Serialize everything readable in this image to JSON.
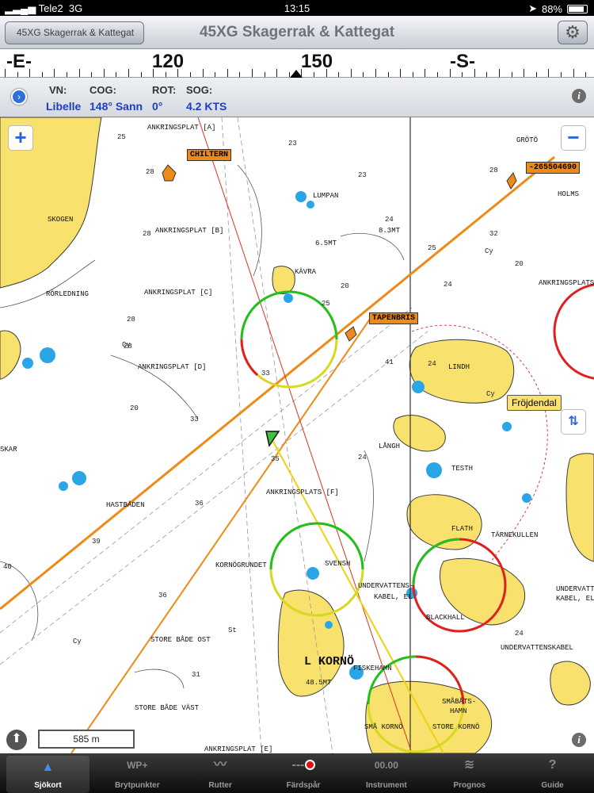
{
  "status_bar": {
    "carrier": "Tele2",
    "network": "3G",
    "time": "13:15",
    "battery": "88%"
  },
  "nav": {
    "back_label": "45XG Skagerrak & Kattegat",
    "title": "45XG Skagerrak & Kattegat"
  },
  "compass": {
    "labels": [
      "-E-",
      "120",
      "150",
      "-S-"
    ]
  },
  "info": {
    "headers": [
      "VN:",
      "COG:",
      "ROT:",
      "SOG:"
    ],
    "values": [
      "Libelle",
      "148° Sann",
      "0°",
      "4.2 KTS"
    ]
  },
  "map": {
    "scale": "585 m",
    "vessel_labels": [
      "CHILTERN",
      "-265504690",
      "TAPENBRIS"
    ],
    "poi_label": "Fröjdendal",
    "names": [
      "ANKRINGSPLAT [A]",
      "SKOGEN",
      "ANKRINGSPLAT [B]",
      "RÖRLEDNING",
      "ANKRINGSPLAT [C]",
      "ANKRINGSPLAT [D]",
      "LUMPAN",
      "KÄVRA",
      "GRÖTÖ",
      "HOLMS",
      "ANKRINGSPLATS [",
      "LINDH",
      "LÅNGH",
      "TESTH",
      "HASTBÅDEN",
      "ANKRINGSPLATS [F]",
      "FLATH",
      "TÄRNEKULLEN",
      "KORNÖGRUNDET",
      "SVENSH",
      "UNDERVATTENS-",
      "KABEL, EL",
      "BLACKHALL",
      "FISKEHAMN",
      "L KORNÖ",
      "STORE BÅDE OST",
      "STORE BÅDE VÄST",
      "UNDERVATTENSKABEL",
      "SMÅBÅTS-",
      "HAMN",
      "SMÅ KORNÖ",
      "STORE KORNÖ",
      "ANKRINGSPLAT [E]",
      "SKAR",
      "UNDERVATTENS-",
      "KABEL, EL",
      "6.5MT",
      "8.3MT",
      "48.5MT"
    ],
    "depths": [
      "25",
      "23",
      "28",
      "28",
      "28",
      "28",
      "Cy",
      "33",
      "20",
      "33",
      "25",
      "20",
      "35",
      "36",
      "39",
      "40",
      "36",
      "Cy",
      "St",
      "31",
      "24",
      "41",
      "24",
      "32",
      "Cy",
      "24",
      "24",
      "Cy",
      "24",
      "23",
      "25",
      "20",
      "28"
    ]
  },
  "tabs": [
    {
      "label": "Sjökort",
      "icon": "chart-triangle-icon"
    },
    {
      "label": "Brytpunkter",
      "icon_text": "WP+"
    },
    {
      "label": "Rutter",
      "icon": "route-icon"
    },
    {
      "label": "Färdspår",
      "icon": "record-icon"
    },
    {
      "label": "Instrument",
      "icon_text": "00.00"
    },
    {
      "label": "Prognos",
      "icon": "weather-icon"
    },
    {
      "label": "Guide",
      "icon_text": "?"
    }
  ],
  "colors": {
    "land": "#f8e16c",
    "shallow": "#2aa6e6",
    "course": "#f08a16",
    "accent": "#1d3fbf"
  }
}
